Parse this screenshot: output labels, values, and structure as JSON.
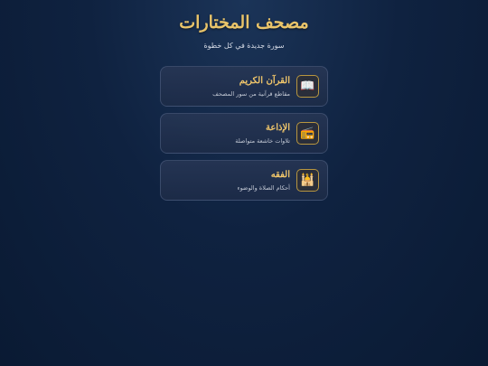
{
  "app": {
    "title": "مصحف المختارات",
    "subtitle": "سورة جديدة في كل خطوة"
  },
  "cards": [
    {
      "title": "القرآن الكريم",
      "description": "مقاطع قرآنية من سور المصحف",
      "icon": "open-book-icon",
      "glyph": "📖"
    },
    {
      "title": "الإذاعة",
      "description": "تلاوات خاشعة متواصلة",
      "icon": "radio-icon",
      "glyph": "📻"
    },
    {
      "title": "الفقه",
      "description": "أحكام الصلاة والوضوء",
      "icon": "mosque-icon",
      "glyph": "🕌"
    }
  ],
  "colors": {
    "accent": "#e9c46a",
    "background": "#0f2240",
    "card_border": "#b8963f"
  }
}
